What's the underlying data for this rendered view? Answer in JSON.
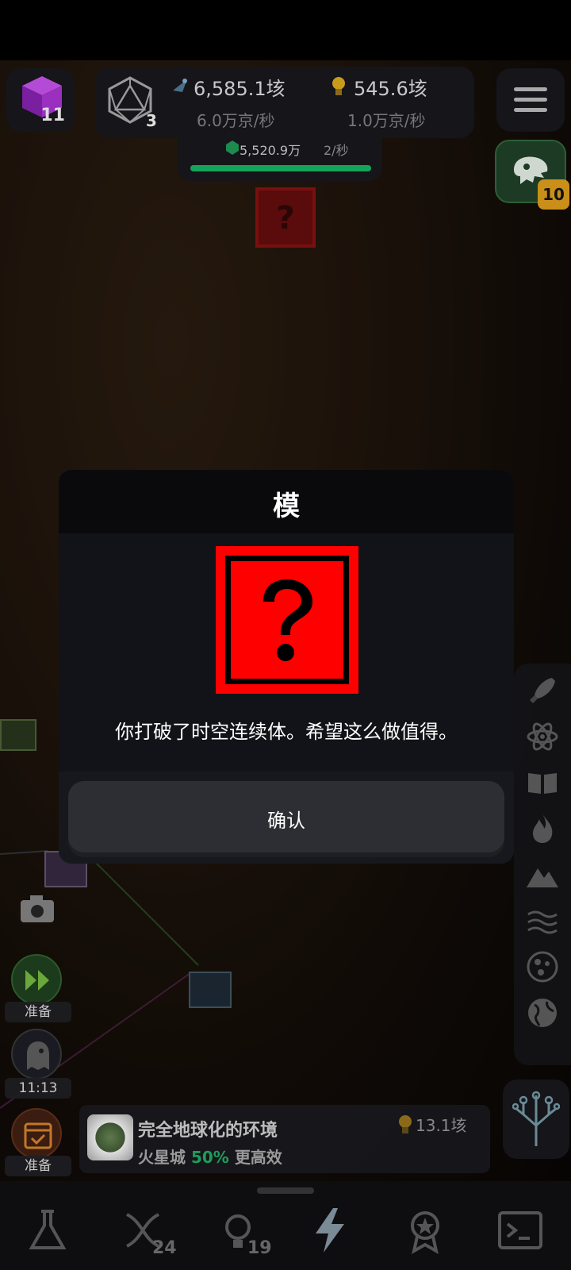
{
  "hud": {
    "cube_count": "11",
    "icosa_count": "3",
    "resource1_value": "6,585.1垓",
    "resource1_rate": "6.0万京/秒",
    "resource2_value": "545.6垓",
    "resource2_rate": "1.0万京/秒",
    "gem_value": "5,520.9万",
    "gem_rate": "2/秒",
    "gem_progress": 1.0,
    "dino_badge": "10"
  },
  "modal": {
    "title": "模",
    "message": "你打破了时空连续体。希望这么做值得。",
    "confirm_label": "确认"
  },
  "left_panel": {
    "ready_label_1": "准备",
    "timer": "11:13",
    "ready_label_2": "准备"
  },
  "info_bar": {
    "title": "完全地球化的环境",
    "subtitle_prefix": "火星城",
    "subtitle_highlight": "50%",
    "subtitle_suffix": "更高效",
    "cost": "13.1垓"
  },
  "bottom_nav": {
    "dna_count": "24",
    "idea_count": "19"
  },
  "colors": {
    "accent_green": "#15a35a",
    "mystery_red": "#ff0000",
    "badge_gold": "#c98f18"
  }
}
